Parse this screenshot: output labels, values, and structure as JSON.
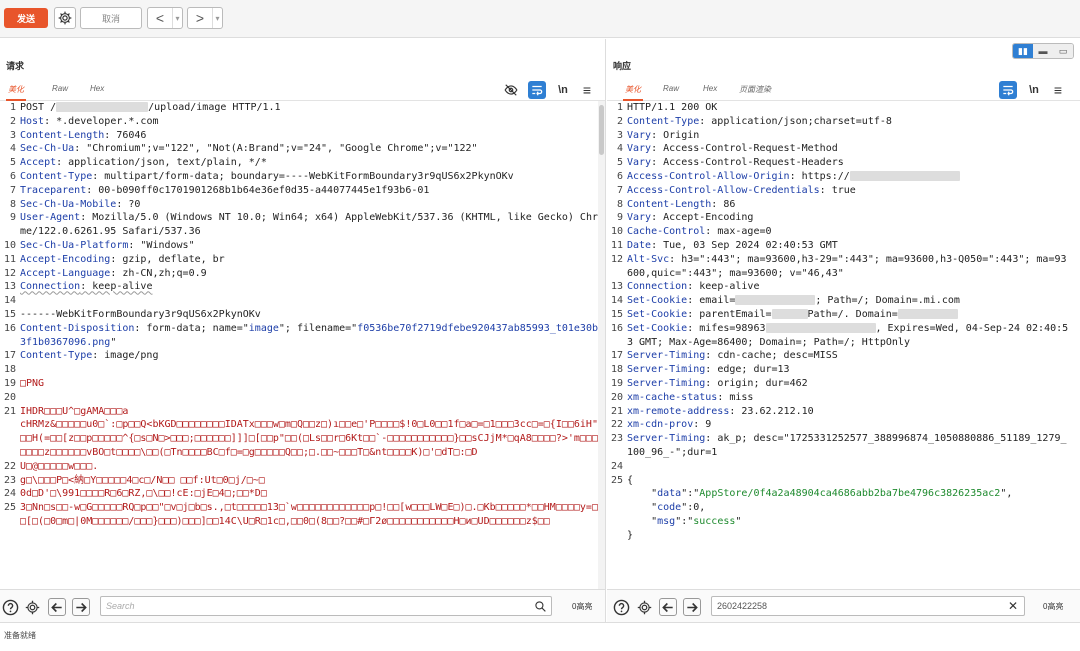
{
  "toolbar": {
    "send_label": "发送",
    "cancel_label": "取消",
    "back_glyph": "<",
    "forward_glyph": ">",
    "dropdown_glyph": "▾"
  },
  "request": {
    "title": "请求",
    "tabs": [
      "美化",
      "Raw",
      "Hex"
    ],
    "newline_label": "\\n",
    "menu_glyph": "≡",
    "lines": [
      {
        "n": "1",
        "segs": [
          {
            "t": "POST /",
            "c": "hv"
          },
          {
            "t": "",
            "c": "redact",
            "w": 92
          },
          {
            "t": "/upload/image HTTP/1.1",
            "c": "hv"
          }
        ]
      },
      {
        "n": "2",
        "segs": [
          {
            "t": "Host",
            "c": "hk"
          },
          {
            "t": ": *.developer.*.com",
            "c": "hv"
          }
        ]
      },
      {
        "n": "3",
        "segs": [
          {
            "t": "Content-Length",
            "c": "hk"
          },
          {
            "t": ": 76046",
            "c": "hv"
          }
        ]
      },
      {
        "n": "4",
        "segs": [
          {
            "t": "Sec-Ch-Ua",
            "c": "hk"
          },
          {
            "t": ": \"Chromium\";v=\"122\", \"Not(A:Brand\";v=\"24\", \"Google Chrome\";v=\"122\"",
            "c": "hv"
          }
        ]
      },
      {
        "n": "5",
        "segs": [
          {
            "t": "Accept",
            "c": "hk"
          },
          {
            "t": ": application/json, text/plain, */*",
            "c": "hv"
          }
        ]
      },
      {
        "n": "6",
        "segs": [
          {
            "t": "Content-Type",
            "c": "hk"
          },
          {
            "t": ": multipart/form-data; boundary=----WebKitFormBoundary3r9qUS6x2PkynOKv",
            "c": "hv"
          }
        ]
      },
      {
        "n": "7",
        "segs": [
          {
            "t": "Traceparent",
            "c": "hk"
          },
          {
            "t": ": 00-b090ff0c1701901268b1b64e36ef0d35-a44077445e1f93b6-01",
            "c": "hv"
          }
        ]
      },
      {
        "n": "8",
        "segs": [
          {
            "t": "Sec-Ch-Ua-Mobile",
            "c": "hk"
          },
          {
            "t": ": ?0",
            "c": "hv"
          }
        ]
      },
      {
        "n": "9",
        "segs": [
          {
            "t": "User-Agent",
            "c": "hk"
          },
          {
            "t": ": Mozilla/5.0 (Windows NT 10.0; Win64; x64) AppleWebKit/537.36 (KHTML, like Gecko) Chrome/122.0.6261.95 Safari/537.36",
            "c": "hv"
          }
        ]
      },
      {
        "n": "10",
        "segs": [
          {
            "t": "Sec-Ch-Ua-Platform",
            "c": "hk"
          },
          {
            "t": ": \"Windows\"",
            "c": "hv"
          }
        ]
      },
      {
        "n": "11",
        "segs": [
          {
            "t": "Accept-Encoding",
            "c": "hk"
          },
          {
            "t": ": gzip, deflate, br",
            "c": "hv"
          }
        ]
      },
      {
        "n": "12",
        "segs": [
          {
            "t": "Accept-Language",
            "c": "hk"
          },
          {
            "t": ": zh-CN,zh;q=0.9",
            "c": "hv"
          }
        ]
      },
      {
        "n": "13",
        "segs": [
          {
            "t": "Connection",
            "c": "hk strike"
          },
          {
            "t": ": keep-alive",
            "c": "hv strike"
          }
        ]
      },
      {
        "n": "14",
        "segs": [
          {
            "t": "",
            "c": "hv"
          }
        ]
      },
      {
        "n": "15",
        "segs": [
          {
            "t": "------WebKitFormBoundary3r9qUS6x2PkynOKv",
            "c": "hv"
          }
        ]
      },
      {
        "n": "16",
        "segs": [
          {
            "t": "Content-Disposition",
            "c": "hk"
          },
          {
            "t": ": form-data; name=\"",
            "c": "hv"
          },
          {
            "t": "image",
            "c": "blue"
          },
          {
            "t": "\"; filename=\"",
            "c": "hv"
          },
          {
            "t": "f0536be70f2719dfebe920437ab85993_t01e30b93f1b0367096.png",
            "c": "blue"
          },
          {
            "t": "\"",
            "c": "hv"
          }
        ]
      },
      {
        "n": "17",
        "segs": [
          {
            "t": "Content-Type",
            "c": "hk"
          },
          {
            "t": ": image/png",
            "c": "hv"
          }
        ]
      },
      {
        "n": "18",
        "segs": [
          {
            "t": "",
            "c": "hv"
          }
        ]
      },
      {
        "n": "19",
        "segs": [
          {
            "t": "□PNG",
            "c": "red"
          }
        ]
      },
      {
        "n": "20",
        "segs": [
          {
            "t": "",
            "c": "hv"
          }
        ]
      },
      {
        "n": "21",
        "segs": [
          {
            "t": "IHDR□□□U^□gAMA□□□a",
            "c": "red"
          }
        ]
      },
      {
        "n": "",
        "segs": [
          {
            "t": "cHRMz&□□□□□u0□`:□p□□Q<bKGD□□□□□□□□IDATx□□□w□m□Q□□z□)ı□□e□'P□□□□$!0□L0□□1f□a□=□1□□□3cc□=□{I□□6iH\"□□□H(=□□[z□□p□□□□□^{□s□N□>□□□;□□□□□□]]]□[□□p\"□□(□Ls□□r□6Kt□□`-□□□□□□□□□□□}□□sCJjM*□qA8□□□□?>'m□□□□□□□□z□□□□□□vBO□t□□□□\\□□(□Tn□□□□BC□f□=□g□□□□□Q□□;□.□□~□□□T□&nt□□□□K)□'□dT□:□D",
            "c": "red"
          }
        ]
      },
      {
        "n": "22",
        "segs": [
          {
            "t": "U□@□□□□□w□□□.",
            "c": "red"
          }
        ]
      },
      {
        "n": "23",
        "segs": [
          {
            "t": "g□\\□□□P□<納□Y□□□□□4□c□/N□□ □□f:Ut□0□j/□~□",
            "c": "red"
          }
        ]
      },
      {
        "n": "24",
        "segs": [
          {
            "t": "0d□D'□\\991□□□□R□6□RZ,□\\□□!cE:□jE□4□;□□*D□",
            "c": "red"
          }
        ]
      },
      {
        "n": "25",
        "segs": [
          {
            "t": "3□Nn□s□□-w□G□□□□□RQ□p□□\"□v□j□b□s.,□t□□□□□13□`w□□□□□□□□□□□□p□!□□[w□□□LW□E□)□.□Kb□□□□□*□□HM□□□□y=□L □[□(□0□m□|0M□□□□□□/□□□}□□□)□□□]□□14C\\U□R□1c□,□□0□(8□□?□□#□Γ2ø□□□□□□□□□□□H□и□UD□□□□□□z$□□",
            "c": "red"
          }
        ]
      }
    ],
    "search_placeholder": "Search",
    "matches": "0高亮"
  },
  "response": {
    "title": "响应",
    "tabs": [
      "美化",
      "Raw",
      "Hex",
      "页面渲染"
    ],
    "newline_label": "\\n",
    "menu_glyph": "≡",
    "lines": [
      {
        "n": "1",
        "segs": [
          {
            "t": "HTTP/1.1 200 OK",
            "c": "hv"
          }
        ]
      },
      {
        "n": "2",
        "segs": [
          {
            "t": "Content-Type",
            "c": "hk"
          },
          {
            "t": ": application/json;charset=utf-8",
            "c": "hv"
          }
        ]
      },
      {
        "n": "3",
        "segs": [
          {
            "t": "Vary",
            "c": "hk"
          },
          {
            "t": ": Origin",
            "c": "hv"
          }
        ]
      },
      {
        "n": "4",
        "segs": [
          {
            "t": "Vary",
            "c": "hk"
          },
          {
            "t": ": Access-Control-Request-Method",
            "c": "hv"
          }
        ]
      },
      {
        "n": "5",
        "segs": [
          {
            "t": "Vary",
            "c": "hk"
          },
          {
            "t": ": Access-Control-Request-Headers",
            "c": "hv"
          }
        ]
      },
      {
        "n": "6",
        "segs": [
          {
            "t": "Access-Control-Allow-Origin",
            "c": "hk"
          },
          {
            "t": ": https://",
            "c": "hv"
          },
          {
            "t": "",
            "c": "redact",
            "w": 110
          }
        ]
      },
      {
        "n": "7",
        "segs": [
          {
            "t": "Access-Control-Allow-Credentials",
            "c": "hk"
          },
          {
            "t": ": true",
            "c": "hv"
          }
        ]
      },
      {
        "n": "8",
        "segs": [
          {
            "t": "Content-Length",
            "c": "hk"
          },
          {
            "t": ": 86",
            "c": "hv"
          }
        ]
      },
      {
        "n": "9",
        "segs": [
          {
            "t": "Vary",
            "c": "hk"
          },
          {
            "t": ": Accept-Encoding",
            "c": "hv"
          }
        ]
      },
      {
        "n": "10",
        "segs": [
          {
            "t": "Cache-Control",
            "c": "hk"
          },
          {
            "t": ": max-age=0",
            "c": "hv"
          }
        ]
      },
      {
        "n": "11",
        "segs": [
          {
            "t": "Date",
            "c": "hk"
          },
          {
            "t": ": Tue, 03 Sep 2024 02:40:53 GMT",
            "c": "hv"
          }
        ]
      },
      {
        "n": "12",
        "segs": [
          {
            "t": "Alt-Svc",
            "c": "hk"
          },
          {
            "t": ": h3=\":443\"; ma=93600,h3-29=\":443\"; ma=93600,h3-Q050=\":443\"; ma=93600,quic=\":443\"; ma=93600; v=\"46,43\"",
            "c": "hv"
          }
        ]
      },
      {
        "n": "13",
        "segs": [
          {
            "t": "Connection",
            "c": "hk"
          },
          {
            "t": ": keep-alive",
            "c": "hv"
          }
        ]
      },
      {
        "n": "14",
        "segs": [
          {
            "t": "Set-Cookie",
            "c": "hk"
          },
          {
            "t": ": email=",
            "c": "hv"
          },
          {
            "t": "",
            "c": "redact",
            "w": 80
          },
          {
            "t": "; Path=/; Domain=.mi.com",
            "c": "hv"
          }
        ]
      },
      {
        "n": "15",
        "segs": [
          {
            "t": "Set-Cookie",
            "c": "hk"
          },
          {
            "t": ": parentEmail=",
            "c": "hv"
          },
          {
            "t": "",
            "c": "redact",
            "w": 36
          },
          {
            "t": "Path=/. Domain=",
            "c": "hv"
          },
          {
            "t": "",
            "c": "redact",
            "w": 60
          }
        ]
      },
      {
        "n": "16",
        "segs": [
          {
            "t": "Set-Cookie",
            "c": "hk"
          },
          {
            "t": ": mifes=98963",
            "c": "hv"
          },
          {
            "t": "",
            "c": "redact",
            "w": 110
          },
          {
            "t": ", Expires=Wed, 04-Sep-24 02:40:53 GMT; Max-Age=86400; Domain=; Path=/; HttpOnly",
            "c": "hv"
          }
        ]
      },
      {
        "n": "17",
        "segs": [
          {
            "t": "Server-Timing",
            "c": "hk"
          },
          {
            "t": ": cdn-cache; desc=MISS",
            "c": "hv"
          }
        ]
      },
      {
        "n": "18",
        "segs": [
          {
            "t": "Server-Timing",
            "c": "hk"
          },
          {
            "t": ": edge; dur=13",
            "c": "hv"
          }
        ]
      },
      {
        "n": "19",
        "segs": [
          {
            "t": "Server-Timing",
            "c": "hk"
          },
          {
            "t": ": origin; dur=462",
            "c": "hv"
          }
        ]
      },
      {
        "n": "20",
        "segs": [
          {
            "t": "xm-cache-status",
            "c": "hk"
          },
          {
            "t": ": miss",
            "c": "hv"
          }
        ]
      },
      {
        "n": "21",
        "segs": [
          {
            "t": "xm-remote-address",
            "c": "hk"
          },
          {
            "t": ": 23.62.212.10",
            "c": "hv"
          }
        ]
      },
      {
        "n": "22",
        "segs": [
          {
            "t": "xm-cdn-prov",
            "c": "hk"
          },
          {
            "t": ": 9",
            "c": "hv"
          }
        ]
      },
      {
        "n": "23",
        "segs": [
          {
            "t": "Server-Timing",
            "c": "hk"
          },
          {
            "t": ": ak_p; desc=\"1725331252577_388996874_1050880886_51189_1279_100_96_-\";dur=1",
            "c": "hv"
          }
        ]
      },
      {
        "n": "24",
        "segs": [
          {
            "t": "",
            "c": "hv"
          }
        ]
      },
      {
        "n": "25",
        "segs": [
          {
            "t": "{",
            "c": "hv"
          }
        ]
      },
      {
        "n": "",
        "segs": [
          {
            "t": "    \"",
            "c": "hv"
          },
          {
            "t": "data",
            "c": "blue"
          },
          {
            "t": "\":\"",
            "c": "hv"
          },
          {
            "t": "AppStore/0f4a2a48904ca4686abb2ba7be4796c3826235ac2",
            "c": "green"
          },
          {
            "t": "\",",
            "c": "hv"
          }
        ]
      },
      {
        "n": "",
        "segs": [
          {
            "t": "    \"",
            "c": "hv"
          },
          {
            "t": "code",
            "c": "blue"
          },
          {
            "t": "\":0,",
            "c": "hv"
          }
        ]
      },
      {
        "n": "",
        "segs": [
          {
            "t": "    \"",
            "c": "hv"
          },
          {
            "t": "msg",
            "c": "blue"
          },
          {
            "t": "\":\"",
            "c": "hv"
          },
          {
            "t": "success",
            "c": "green"
          },
          {
            "t": "\"",
            "c": "hv"
          }
        ]
      },
      {
        "n": "",
        "segs": [
          {
            "t": "}",
            "c": "hv"
          }
        ]
      }
    ],
    "search_value": "2602422258",
    "matches": "0高亮"
  },
  "status": {
    "text": "准备就绪"
  },
  "colors": {
    "accent": "#e8552b",
    "selected": "#2f7fd3",
    "header_key": "#1d3ea8",
    "binary": "#b21a1a",
    "json_string": "#1e8a2e"
  }
}
